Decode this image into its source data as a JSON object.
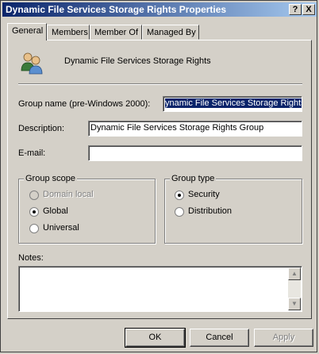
{
  "window": {
    "title": "Dynamic File Services Storage Rights Properties",
    "help_button": "?",
    "close_button": "X"
  },
  "tabs": [
    {
      "label": "General"
    },
    {
      "label": "Members"
    },
    {
      "label": "Member Of"
    },
    {
      "label": "Managed By"
    }
  ],
  "general": {
    "group_display_name": "Dynamic File Services Storage Rights",
    "group_name_label": "Group name (pre-Windows 2000):",
    "group_name_value": "ynamic File Services Storage Rights",
    "description_label": "Description:",
    "description_value": "Dynamic File Services Storage Rights Group",
    "email_label": "E-mail:",
    "email_value": "",
    "group_scope": {
      "title": "Group scope",
      "options": [
        "Domain local",
        "Global",
        "Universal"
      ],
      "selected": "Global",
      "disabled": [
        "Domain local"
      ]
    },
    "group_type": {
      "title": "Group type",
      "options": [
        "Security",
        "Distribution"
      ],
      "selected": "Security"
    },
    "notes_label": "Notes:",
    "notes_value": ""
  },
  "buttons": {
    "ok": "OK",
    "cancel": "Cancel",
    "apply": "Apply"
  },
  "colors": {
    "titlebar_start": "#0a246a",
    "titlebar_end": "#a6caf0",
    "dialog_face": "#d4d0c8",
    "selection": "#0a246a"
  }
}
